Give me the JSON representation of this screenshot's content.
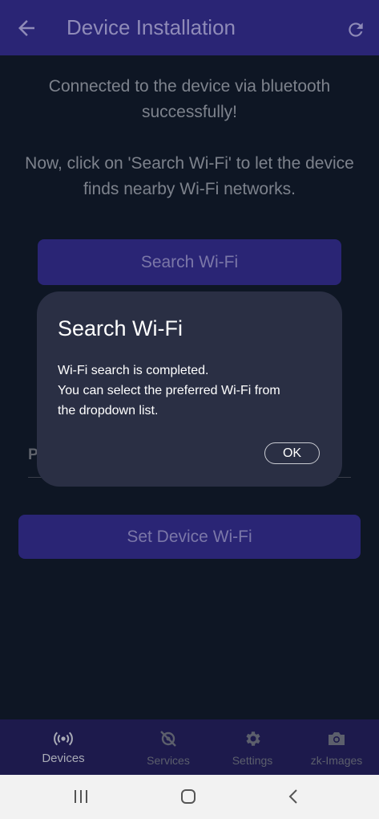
{
  "app_bar": {
    "title": "Device Installation",
    "back_icon": "arrow-left-icon",
    "refresh_icon": "refresh-icon"
  },
  "main": {
    "message_connected": "Connected to the device via bluetooth successfully!",
    "message_instruction": "Now, click on 'Search Wi-Fi' to let the device finds nearby Wi-Fi networks.",
    "search_button_label": "Search Wi-Fi",
    "password_label_partial": "P",
    "set_button_label": "Set Device Wi-Fi"
  },
  "dialog": {
    "title": "Search Wi-Fi",
    "body_lines": [
      "Wi-Fi search is completed.",
      "You can select the preferred Wi-Fi from",
      "the dropdown list."
    ],
    "ok_label": "OK"
  },
  "bottom_nav": {
    "items": [
      {
        "label": "Devices",
        "icon": "broadcast-icon",
        "active": true
      },
      {
        "label": "Services",
        "icon": "services-icon",
        "active": false
      },
      {
        "label": "Settings",
        "icon": "gear-icon",
        "active": false
      },
      {
        "label": "zk-Images",
        "icon": "camera-icon",
        "active": false
      }
    ]
  },
  "system_bar": {
    "recents_icon": "recents-icon",
    "home_icon": "home-icon",
    "back_icon": "system-back-icon"
  },
  "colors": {
    "app_bar": "#2a2575",
    "background": "#0e1624",
    "dialog": "#2a2f44",
    "button": "#2a2575"
  }
}
